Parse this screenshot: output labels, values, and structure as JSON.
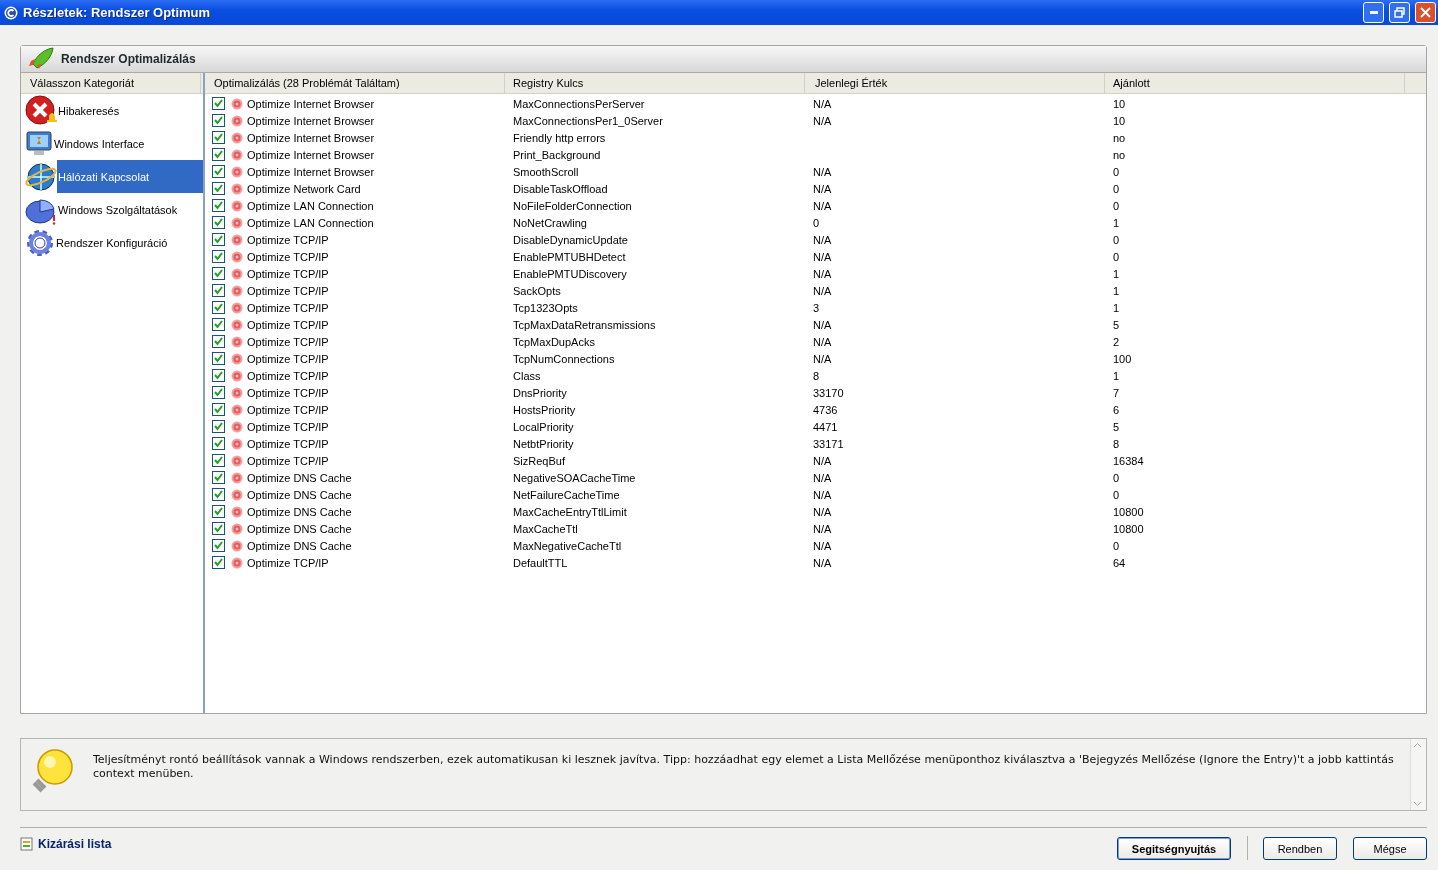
{
  "window": {
    "title": "Részletek: Rendszer Optimum"
  },
  "panel": {
    "title": "Rendszer Optimalizálás"
  },
  "sidebar": {
    "header": "Válasszon Kategoriát",
    "items": [
      {
        "label": "Hibakeresés",
        "kind": "error",
        "selected": false
      },
      {
        "label": "Windows Interface",
        "kind": "monitor",
        "selected": false
      },
      {
        "label": "Hálózati Kapcsolat",
        "kind": "network",
        "selected": true
      },
      {
        "label": "Windows Szolgáltatások",
        "kind": "services",
        "selected": false
      },
      {
        "label": "Rendszer Konfiguráció",
        "kind": "gear",
        "selected": false
      }
    ]
  },
  "table": {
    "columns": [
      "Optimalizálás (28 Problémát Találtam)",
      "Registry Kulcs",
      "Jelenlegi Érték",
      "Ajánlott"
    ],
    "rows": [
      {
        "checked": true,
        "item": "Optimize Internet Browser",
        "key": "MaxConnectionsPerServer",
        "current": "N/A",
        "recommended": "10"
      },
      {
        "checked": true,
        "item": "Optimize Internet Browser",
        "key": "MaxConnectionsPer1_0Server",
        "current": "N/A",
        "recommended": "10"
      },
      {
        "checked": true,
        "item": "Optimize Internet Browser",
        "key": "Friendly http errors",
        "recommended": "no"
      },
      {
        "checked": true,
        "item": "Optimize Internet Browser",
        "key": "Print_Background",
        "recommended": "no"
      },
      {
        "checked": true,
        "item": "Optimize Internet Browser",
        "key": "SmoothScroll",
        "current": "N/A",
        "recommended": "0"
      },
      {
        "checked": true,
        "item": "Optimize Network Card",
        "key": "DisableTaskOffload",
        "current": "N/A",
        "recommended": "0"
      },
      {
        "checked": true,
        "item": "Optimize LAN Connection",
        "key": "NoFileFolderConnection",
        "current": "N/A",
        "recommended": "0"
      },
      {
        "checked": true,
        "item": "Optimize LAN Connection",
        "key": "NoNetCrawling",
        "current": "0",
        "recommended": "1"
      },
      {
        "checked": true,
        "item": "Optimize TCP/IP",
        "key": "DisableDynamicUpdate",
        "current": "N/A",
        "recommended": "0"
      },
      {
        "checked": true,
        "item": "Optimize TCP/IP",
        "key": "EnablePMTUBHDetect",
        "current": "N/A",
        "recommended": "0"
      },
      {
        "checked": true,
        "item": "Optimize TCP/IP",
        "key": "EnablePMTUDiscovery",
        "current": "N/A",
        "recommended": "1"
      },
      {
        "checked": true,
        "item": "Optimize TCP/IP",
        "key": "SackOpts",
        "current": "N/A",
        "recommended": "1"
      },
      {
        "checked": true,
        "item": "Optimize TCP/IP",
        "key": "Tcp1323Opts",
        "current": "3",
        "recommended": "1"
      },
      {
        "checked": true,
        "item": "Optimize TCP/IP",
        "key": "TcpMaxDataRetransmissions",
        "current": "N/A",
        "recommended": "5"
      },
      {
        "checked": true,
        "item": "Optimize TCP/IP",
        "key": "TcpMaxDupAcks",
        "current": "N/A",
        "recommended": "2"
      },
      {
        "checked": true,
        "item": "Optimize TCP/IP",
        "key": "TcpNumConnections",
        "current": "N/A",
        "recommended": "100"
      },
      {
        "checked": true,
        "item": "Optimize TCP/IP",
        "key": "Class",
        "current": "8",
        "recommended": "1"
      },
      {
        "checked": true,
        "item": "Optimize TCP/IP",
        "key": "DnsPriority",
        "current": "33170",
        "recommended": "7"
      },
      {
        "checked": true,
        "item": "Optimize TCP/IP",
        "key": "HostsPriority",
        "current": "4736",
        "recommended": "6"
      },
      {
        "checked": true,
        "item": "Optimize TCP/IP",
        "key": "LocalPriority",
        "current": "4471",
        "recommended": "5"
      },
      {
        "checked": true,
        "item": "Optimize TCP/IP",
        "key": "NetbtPriority",
        "current": "33171",
        "recommended": "8"
      },
      {
        "checked": true,
        "item": "Optimize TCP/IP",
        "key": "SizReqBuf",
        "current": "N/A",
        "recommended": "16384"
      },
      {
        "checked": true,
        "item": "Optimize DNS Cache",
        "key": "NegativeSOACacheTime",
        "current": "N/A",
        "recommended": "0"
      },
      {
        "checked": true,
        "item": "Optimize DNS Cache",
        "key": "NetFailureCacheTime",
        "current": "N/A",
        "recommended": "0"
      },
      {
        "checked": true,
        "item": "Optimize DNS Cache",
        "key": "MaxCacheEntryTtlLimit",
        "current": "N/A",
        "recommended": "10800"
      },
      {
        "checked": true,
        "item": "Optimize DNS Cache",
        "key": "MaxCacheTtl",
        "current": "N/A",
        "recommended": "10800"
      },
      {
        "checked": true,
        "item": "Optimize DNS Cache",
        "key": "MaxNegativeCacheTtl",
        "current": "N/A",
        "recommended": "0"
      },
      {
        "checked": true,
        "item": "Optimize TCP/IP",
        "key": "DefaultTTL",
        "current": "N/A",
        "recommended": "64"
      }
    ]
  },
  "info": {
    "text": "Teljesítményt rontó beállítások vannak a Windows rendszerben, ezek automatikusan ki lesznek javítva. Tipp: hozzáadhat egy elemet a Lista Mellőzése menüponthoz kiválasztva a 'Bejegyzés Mellőzése (Ignore the Entry)'t a jobb kattintás context menüben."
  },
  "footer": {
    "link": "Kizárási lista",
    "buttons": [
      {
        "label": "Segitségnyujtás",
        "default": true
      },
      {
        "label": "Rendben",
        "default": false
      },
      {
        "label": "Mégse",
        "default": false
      }
    ]
  }
}
